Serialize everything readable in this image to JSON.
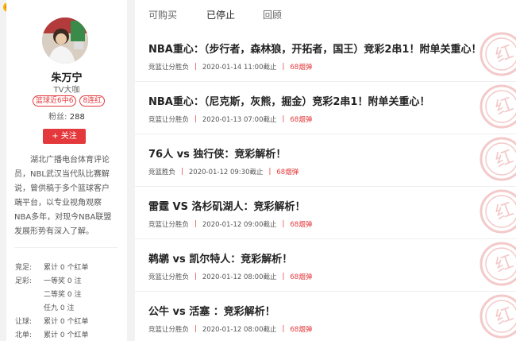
{
  "profile": {
    "name": "朱万宁",
    "title": "TV大咖",
    "badges": [
      "篮球近6中6",
      "8连红"
    ],
    "fans_label": "粉丝:",
    "fans_count": "288",
    "follow_label": "+ 关注",
    "bio": "湖北广播电台体育评论员，NBL武汉当代队比赛解说，曾供稿于多个篮球客户端平台，以专业视角观察NBA多年，对现今NBA联盟发展形势有深入了解。"
  },
  "stats": [
    {
      "label": "竞足:",
      "value": "累计 0 个红单"
    },
    {
      "label": "足彩:",
      "value": "一等奖 0 注"
    },
    {
      "label": "",
      "value": "二等奖 0 注"
    },
    {
      "label": "",
      "value": "任九 0 注"
    },
    {
      "label": "让球:",
      "value": "累计 0 个红单"
    },
    {
      "label": "北单:",
      "value": "累计 0 个红单"
    }
  ],
  "tabs": [
    {
      "label": "可购买",
      "active": false
    },
    {
      "label": "已停止",
      "active": true
    },
    {
      "label": "回顾",
      "active": false
    }
  ],
  "articles": [
    {
      "title": "NBA重心：（步行者，森林狼，开拓者，国王）竞彩2串1！附单关重心！",
      "category": "竞篮让分胜负",
      "time": "2020-01-14 11:00截止",
      "price": "68烟弹"
    },
    {
      "title": "NBA重心：（尼克斯，灰熊，掘金）竞彩2串1！附单关重心！",
      "category": "竞篮让分胜负",
      "time": "2020-01-13 07:00截止",
      "price": "68烟弹"
    },
    {
      "title": "76人 vs 独行侠：竞彩解析！",
      "category": "竞篮胜负",
      "time": "2020-01-12 09:30截止",
      "price": "68烟弹"
    },
    {
      "title": "雷霆 VS 洛杉矶湖人：竞彩解析！",
      "category": "竞篮让分胜负",
      "time": "2020-01-12 09:00截止",
      "price": "68烟弹"
    },
    {
      "title": "鹈鹕 vs 凯尔特人：竞彩解析！",
      "category": "竞篮让分胜负",
      "time": "2020-01-12 08:00截止",
      "price": "68烟弹"
    },
    {
      "title": "公牛 vs 活塞 ：竞彩解析！",
      "category": "竞篮让分胜负",
      "time": "2020-01-12 08:00截止",
      "price": "68烟弹"
    }
  ],
  "stamp_text": "红",
  "colors": {
    "accent": "#e4393c",
    "stamp": "#f3c9c9"
  }
}
